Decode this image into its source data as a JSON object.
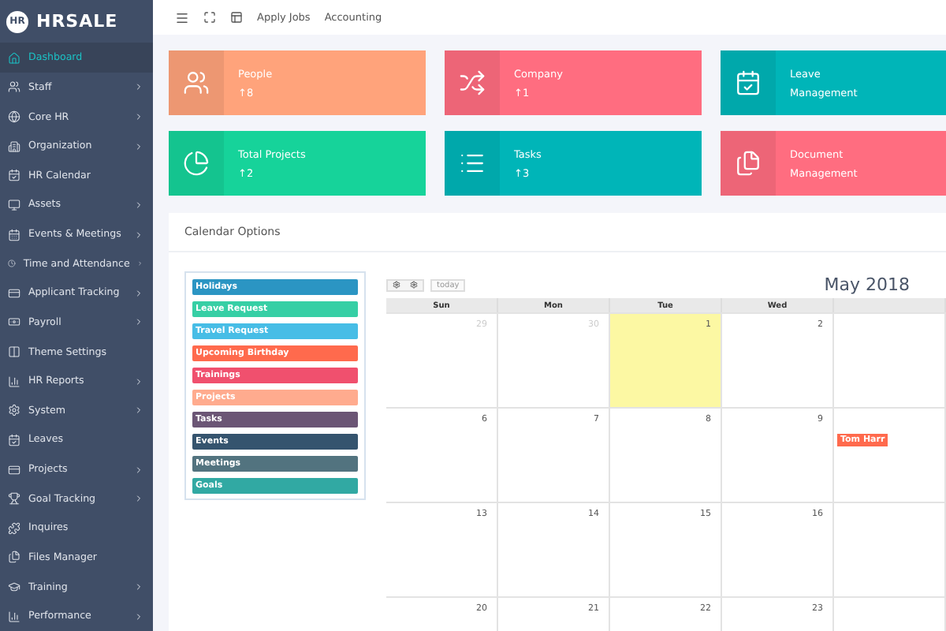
{
  "brand": {
    "mark": "HR",
    "name": "HRSALE"
  },
  "sidebar": {
    "items": [
      {
        "label": "Dashboard",
        "selected": true,
        "has_submenu": false
      },
      {
        "label": "Staff",
        "selected": false,
        "has_submenu": true
      },
      {
        "label": "Core HR",
        "selected": false,
        "has_submenu": true
      },
      {
        "label": "Organization",
        "selected": false,
        "has_submenu": true
      },
      {
        "label": "HR Calendar",
        "selected": false,
        "has_submenu": false
      },
      {
        "label": "Assets",
        "selected": false,
        "has_submenu": true
      },
      {
        "label": "Events & Meetings",
        "selected": false,
        "has_submenu": true
      },
      {
        "label": "Time and Attendance",
        "selected": false,
        "has_submenu": true
      },
      {
        "label": "Applicant Tracking",
        "selected": false,
        "has_submenu": true
      },
      {
        "label": "Payroll",
        "selected": false,
        "has_submenu": true
      },
      {
        "label": "Theme Settings",
        "selected": false,
        "has_submenu": false
      },
      {
        "label": "HR Reports",
        "selected": false,
        "has_submenu": true
      },
      {
        "label": "System",
        "selected": false,
        "has_submenu": true
      },
      {
        "label": "Leaves",
        "selected": false,
        "has_submenu": false
      },
      {
        "label": "Projects",
        "selected": false,
        "has_submenu": true
      },
      {
        "label": "Goal Tracking",
        "selected": false,
        "has_submenu": true
      },
      {
        "label": "Inquires",
        "selected": false,
        "has_submenu": false
      },
      {
        "label": "Files Manager",
        "selected": false,
        "has_submenu": false
      },
      {
        "label": "Training",
        "selected": false,
        "has_submenu": true
      },
      {
        "label": "Performance",
        "selected": false,
        "has_submenu": true
      }
    ]
  },
  "topbar": {
    "links": [
      "Apply Jobs",
      "Accounting"
    ]
  },
  "stat_cards": [
    {
      "title": "People",
      "value": "↑8",
      "color": "#ffa37b"
    },
    {
      "title": "Company",
      "value": "↑1",
      "color": "#ff6d80"
    },
    {
      "title": "Leave",
      "value": "Management",
      "color": "#00b5b8"
    },
    {
      "title": "Total Projects",
      "value": "↑2",
      "color": "#16d39a"
    },
    {
      "title": "Tasks",
      "value": "↑3",
      "color": "#00b5b8"
    },
    {
      "title": "Document",
      "value": "Management",
      "color": "#ff6d80"
    }
  ],
  "calendar_options": {
    "title": "Calendar Options",
    "legend": [
      {
        "label": "Holidays",
        "color": "#2b95c3"
      },
      {
        "label": "Leave Request",
        "color": "#36cfa5"
      },
      {
        "label": "Travel Request",
        "color": "#47bde6"
      },
      {
        "label": "Upcoming Birthday",
        "color": "#ff6a4d"
      },
      {
        "label": "Trainings",
        "color": "#f0506e"
      },
      {
        "label": "Projects",
        "color": "#ffab8e"
      },
      {
        "label": "Tasks",
        "color": "#6b5575"
      },
      {
        "label": "Events",
        "color": "#35546e"
      },
      {
        "label": "Meetings",
        "color": "#52737f"
      },
      {
        "label": "Goals",
        "color": "#31a9a3"
      }
    ]
  },
  "calendar": {
    "today_button": "today",
    "month": "May 2018",
    "columns": [
      "Sun",
      "Mon",
      "Tue",
      "Wed"
    ],
    "weeks": [
      {
        "days": [
          {
            "number": "29",
            "other_month": true,
            "today": false
          },
          {
            "number": "30",
            "other_month": true,
            "today": false
          },
          {
            "number": "1",
            "other_month": false,
            "today": true
          },
          {
            "number": "2",
            "other_month": false,
            "today": false
          }
        ]
      },
      {
        "days": [
          {
            "number": "6",
            "other_month": false,
            "today": false
          },
          {
            "number": "7",
            "other_month": false,
            "today": false
          },
          {
            "number": "8",
            "other_month": false,
            "today": false
          },
          {
            "number": "9",
            "other_month": false,
            "today": false
          }
        ],
        "column_5_event": {
          "label": "Tom Harr",
          "color": "#ff6a4d"
        }
      },
      {
        "days": [
          {
            "number": "13",
            "other_month": false,
            "today": false
          },
          {
            "number": "14",
            "other_month": false,
            "today": false
          },
          {
            "number": "15",
            "other_month": false,
            "today": false
          },
          {
            "number": "16",
            "other_month": false,
            "today": false
          }
        ]
      },
      {
        "days": [
          {
            "number": "20",
            "other_month": false,
            "today": false
          },
          {
            "number": "21",
            "other_month": false,
            "today": false
          },
          {
            "number": "22",
            "other_month": false,
            "today": false
          },
          {
            "number": "23",
            "other_month": false,
            "today": false
          }
        ]
      }
    ]
  }
}
